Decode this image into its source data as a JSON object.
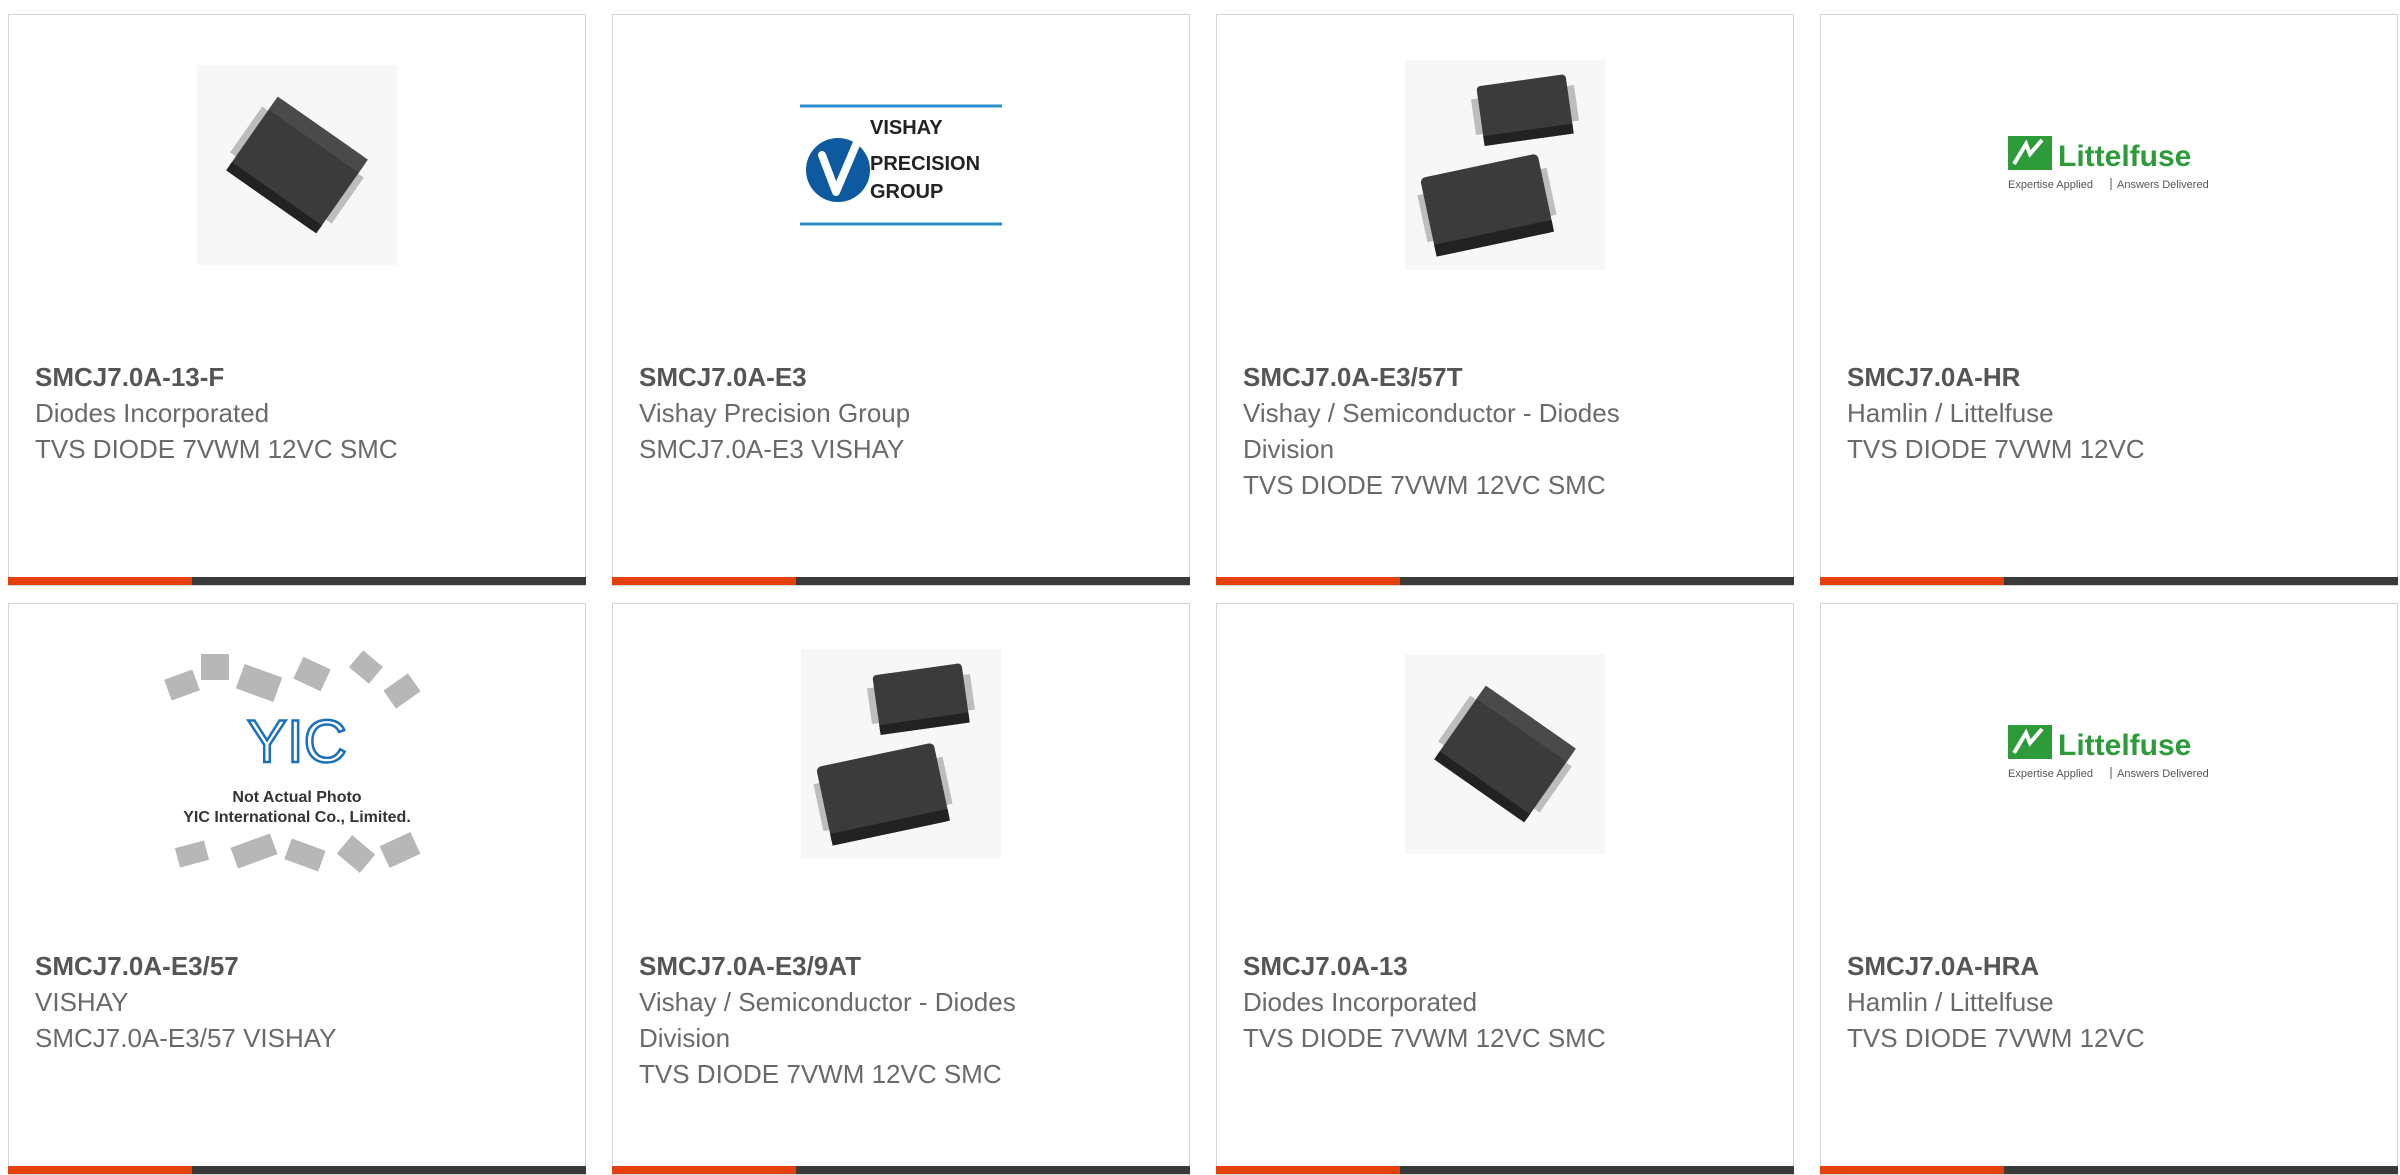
{
  "cards": [
    {
      "part": "SMCJ7.0A-13-F",
      "manufacturer": "Diodes Incorporated",
      "description": "TVS DIODE 7VWM 12VC SMC",
      "image": "smc-package-single"
    },
    {
      "part": "SMCJ7.0A-E3",
      "manufacturer": "Vishay Precision Group",
      "description": "SMCJ7.0A-E3 VISHAY",
      "image": "vishay-precision-group-logo",
      "logo": {
        "line1": "VISHAY",
        "line2": "PRECISION",
        "line3": "GROUP"
      }
    },
    {
      "part": "SMCJ7.0A-E3/57T",
      "manufacturer": "Vishay / Semiconductor - Diodes Division",
      "description": "TVS DIODE 7VWM 12VC SMC",
      "image": "smc-package-pair"
    },
    {
      "part": "SMCJ7.0A-HR",
      "manufacturer": "Hamlin / Littelfuse",
      "description": "TVS DIODE 7VWM 12VC",
      "image": "littelfuse-logo",
      "logo": {
        "brand": "Littelfuse",
        "tagline_left": "Expertise Applied",
        "tagline_right": "Answers Delivered"
      }
    },
    {
      "part": "SMCJ7.0A-E3/57",
      "manufacturer": "VISHAY",
      "description": "SMCJ7.0A-E3/57 VISHAY",
      "image": "yic-placeholder",
      "logo": {
        "mark": "YIC",
        "line1": "Not Actual Photo",
        "line2": "YIC International Co., Limited."
      }
    },
    {
      "part": "SMCJ7.0A-E3/9AT",
      "manufacturer": "Vishay / Semiconductor - Diodes Division",
      "description": "TVS DIODE 7VWM 12VC SMC",
      "image": "smc-package-pair"
    },
    {
      "part": "SMCJ7.0A-13",
      "manufacturer": "Diodes Incorporated",
      "description": "TVS DIODE 7VWM 12VC SMC",
      "image": "smc-package-single"
    },
    {
      "part": "SMCJ7.0A-HRA",
      "manufacturer": "Hamlin / Littelfuse",
      "description": "TVS DIODE 7VWM 12VC",
      "image": "littelfuse-logo",
      "logo": {
        "brand": "Littelfuse",
        "tagline_left": "Expertise Applied",
        "tagline_right": "Answers Delivered"
      }
    }
  ],
  "colors": {
    "accent": "#e3400a",
    "bar": "#3a3a3a",
    "border": "#d4d4d4",
    "title_text": "#555555",
    "body_text": "#6a6a6a"
  }
}
